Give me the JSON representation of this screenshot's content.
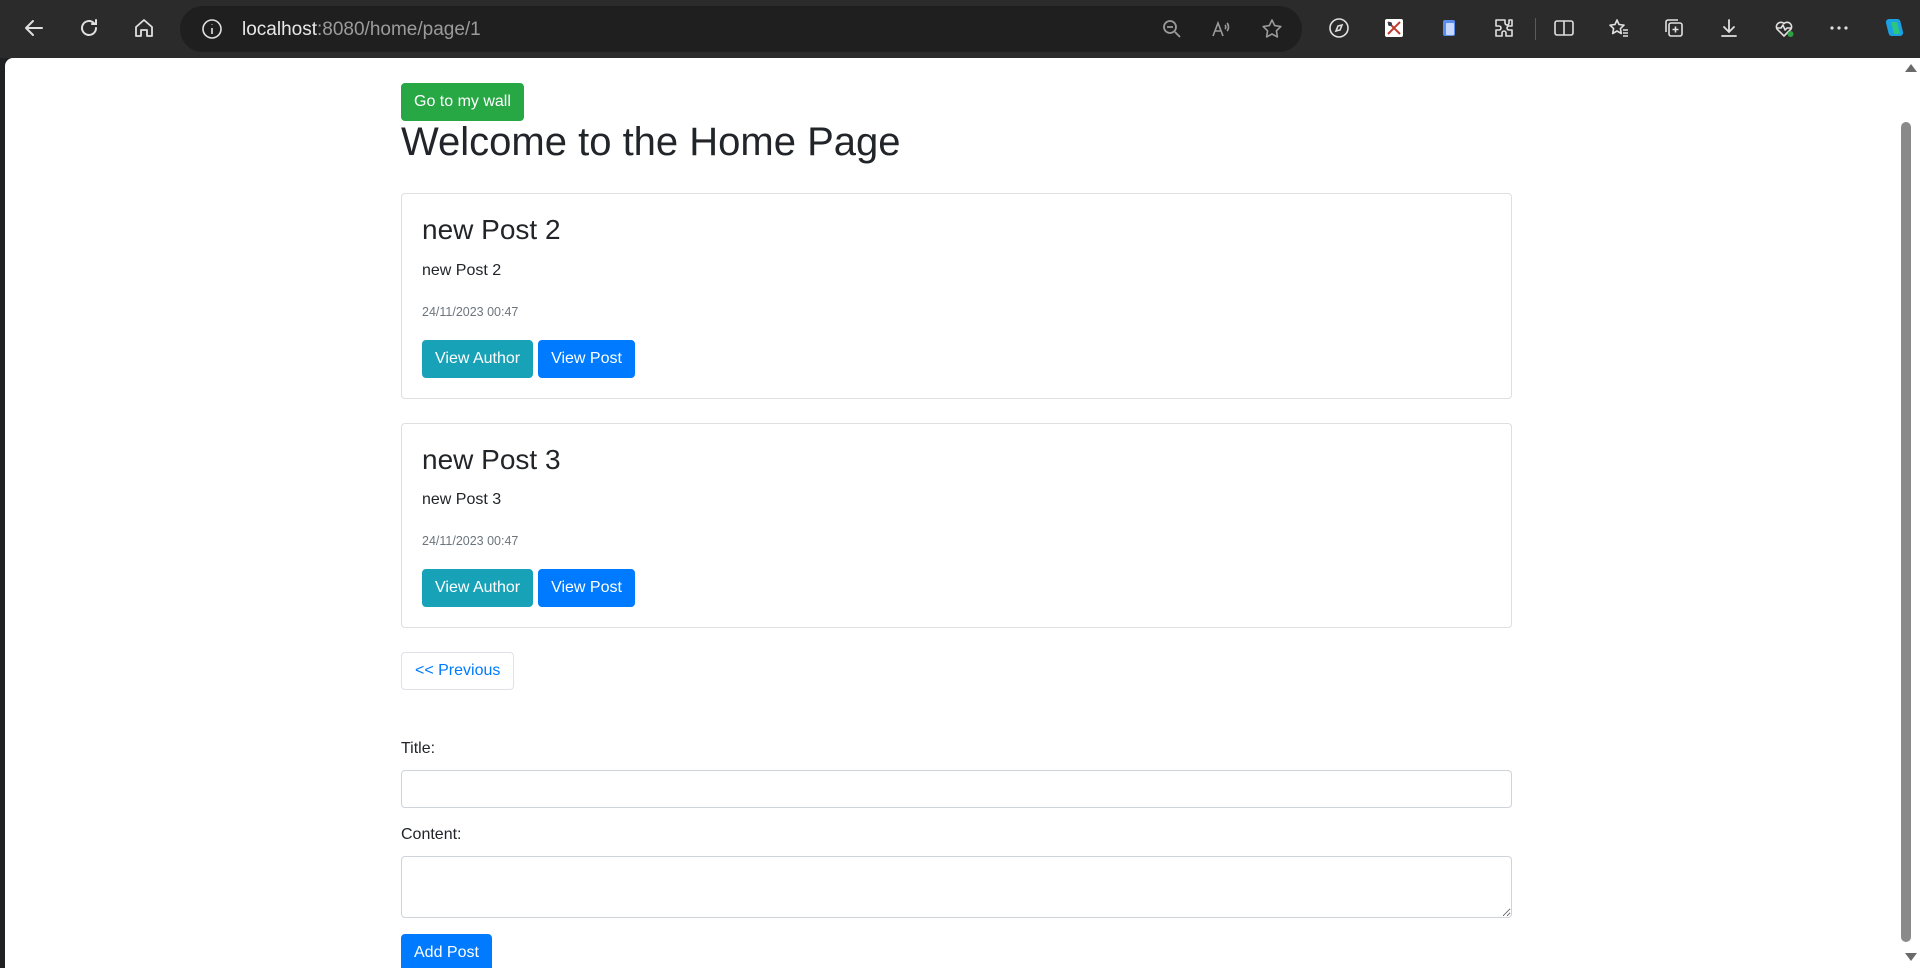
{
  "browser": {
    "url_host": "localhost",
    "url_rest": ":8080/home/page/1"
  },
  "page": {
    "wall_button": "Go to my wall",
    "title": "Welcome to the Home Page",
    "posts": [
      {
        "title": "new Post 2",
        "content": "new Post 2",
        "date": "24/11/2023 00:47",
        "view_author": "View Author",
        "view_post": "View Post"
      },
      {
        "title": "new Post 3",
        "content": "new Post 3",
        "date": "24/11/2023 00:47",
        "view_author": "View Author",
        "view_post": "View Post"
      }
    ],
    "previous_button": "<< Previous",
    "form": {
      "title_label": "Title:",
      "title_value": "",
      "content_label": "Content:",
      "content_value": "",
      "submit": "Add Post"
    }
  },
  "colors": {
    "success": "#28a745",
    "info": "#17a2b8",
    "primary": "#007bff"
  }
}
